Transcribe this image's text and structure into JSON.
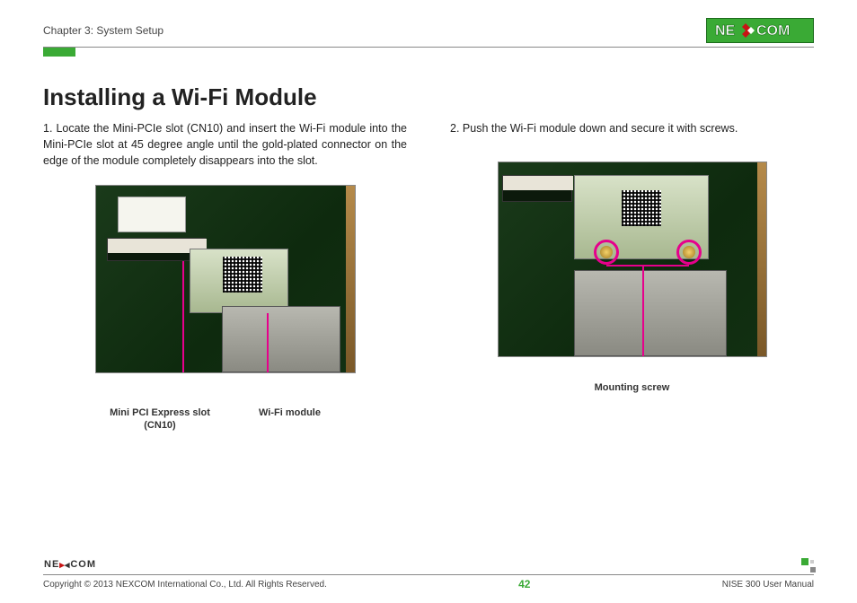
{
  "header": {
    "chapter": "Chapter 3: System Setup"
  },
  "logo": {
    "brand_text": "NEXCOM"
  },
  "title": "Installing a Wi-Fi Module",
  "step1": {
    "num": "1.",
    "text": "Locate the Mini-PCIe slot (CN10) and insert the Wi-Fi module into the Mini-PCIe slot at 45 degree angle until the gold-plated connector on the edge of the module completely disappears into the slot.",
    "caption_left_line1": "Mini PCI Express slot",
    "caption_left_line2": "(CN10)",
    "caption_right": "Wi-Fi module"
  },
  "step2": {
    "num": "2.",
    "text": "Push the Wi-Fi module down and secure it with screws.",
    "caption": "Mounting screw"
  },
  "footer": {
    "copyright": "Copyright © 2013 NEXCOM International Co., Ltd. All Rights Reserved.",
    "page": "42",
    "doc": "NISE 300 User Manual"
  }
}
